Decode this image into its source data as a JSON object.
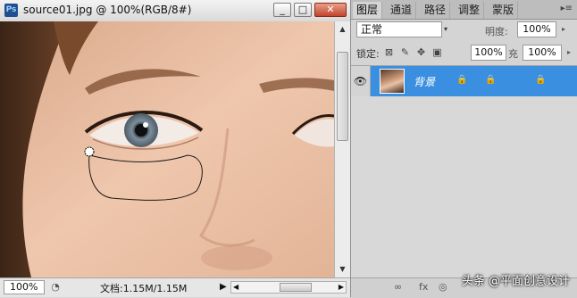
{
  "window": {
    "app_icon": "Ps",
    "title": "source01.jpg @ 100%(RGB/8#)",
    "buttons": {
      "minimize": "_",
      "restore": "□",
      "close": "✕"
    }
  },
  "statusbar": {
    "zoom": "100%",
    "doc_info": "文档:1.15M/1.15M",
    "play_glyph": "▶",
    "scroll_left": "◀",
    "scroll_right": "▶"
  },
  "vscroll": {
    "up": "▲",
    "down": "▼"
  },
  "panel": {
    "tabs": [
      "图层",
      "通道",
      "路径",
      "调整",
      "蒙版"
    ],
    "active_tab": 0,
    "menu_glyph": "▸≡",
    "blend_mode": "正常",
    "opacity_label": "明度:",
    "opacity_value": "100%",
    "lock_label": "锁定:",
    "fill_value_partial": "100%",
    "fill_label": "充",
    "fill_value": "100%",
    "arrow": "▸",
    "layer": {
      "name": "背景",
      "visible_glyph": "👁"
    },
    "footer_icons": [
      "∞",
      "fx",
      "◎"
    ]
  },
  "watermark": "头条 @平面创意设计",
  "colors": {
    "selected_layer": "#3a8fe0",
    "selection_path": "#1a1a1a"
  }
}
